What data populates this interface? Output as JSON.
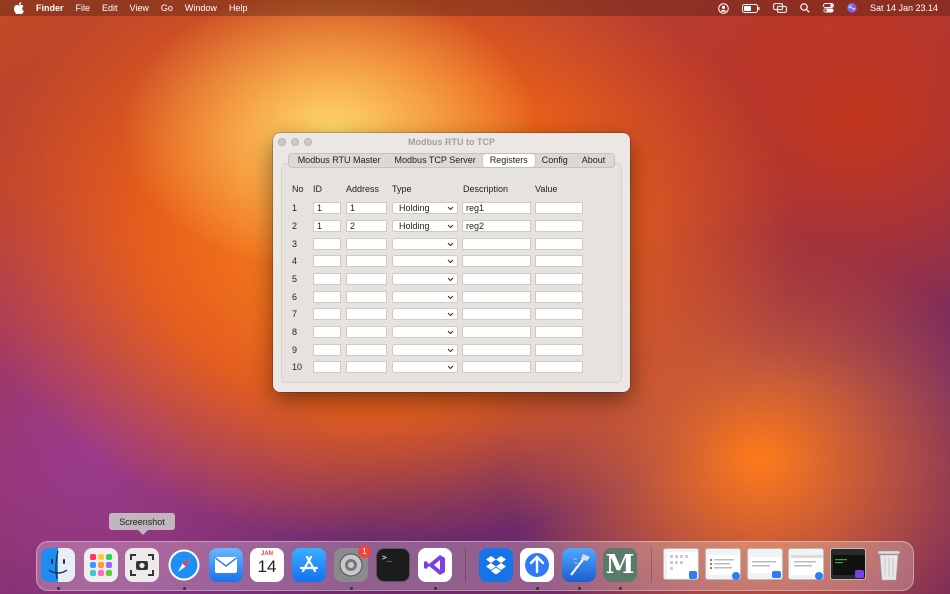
{
  "menubar": {
    "app": "Finder",
    "items": [
      "File",
      "Edit",
      "View",
      "Go",
      "Window",
      "Help"
    ],
    "clock": "Sat 14 Jan  23.14",
    "status_icons": [
      "user-icon",
      "battery-icon",
      "screen-mirroring-icon",
      "spotlight-search-icon",
      "control-center-icon",
      "siri-icon"
    ]
  },
  "window": {
    "title": "Modbus RTU to TCP",
    "tabs": [
      "Modbus RTU Master",
      "Modbus TCP Server",
      "Registers",
      "Config",
      "About"
    ],
    "selected_tab": "Registers",
    "columns": [
      "No",
      "ID",
      "Address",
      "Type",
      "Description",
      "Value"
    ],
    "rows": [
      {
        "no": "1",
        "id": "1",
        "address": "1",
        "type": "Holding",
        "description": "reg1",
        "value": ""
      },
      {
        "no": "2",
        "id": "1",
        "address": "2",
        "type": "Holding",
        "description": "reg2",
        "value": ""
      },
      {
        "no": "3",
        "id": "",
        "address": "",
        "type": "",
        "description": "",
        "value": ""
      },
      {
        "no": "4",
        "id": "",
        "address": "",
        "type": "",
        "description": "",
        "value": ""
      },
      {
        "no": "5",
        "id": "",
        "address": "",
        "type": "",
        "description": "",
        "value": ""
      },
      {
        "no": "6",
        "id": "",
        "address": "",
        "type": "",
        "description": "",
        "value": ""
      },
      {
        "no": "7",
        "id": "",
        "address": "",
        "type": "",
        "description": "",
        "value": ""
      },
      {
        "no": "8",
        "id": "",
        "address": "",
        "type": "",
        "description": "",
        "value": ""
      },
      {
        "no": "9",
        "id": "",
        "address": "",
        "type": "",
        "description": "",
        "value": ""
      },
      {
        "no": "10",
        "id": "",
        "address": "",
        "type": "",
        "description": "",
        "value": ""
      }
    ]
  },
  "tooltip": "Screenshot",
  "dock": {
    "calendar_month": "JAN",
    "calendar_day": "14",
    "settings_badge": "1",
    "terminal_prompt": ">_",
    "m_letter": "M",
    "apps": [
      "finder-icon",
      "launchpad-icon",
      "screenshot-icon",
      "safari-icon",
      "mail-icon",
      "calendar-icon",
      "app-store-icon",
      "system-settings-icon",
      "terminal-icon",
      "visual-studio-icon",
      "dropbox-icon",
      "transmit-icon",
      "xcode-icon",
      "m-app-icon"
    ]
  },
  "colors": {
    "accent_blue": "#2f7cf6",
    "badge_red": "#f0443a",
    "window_bg": "#ebe7e4"
  }
}
